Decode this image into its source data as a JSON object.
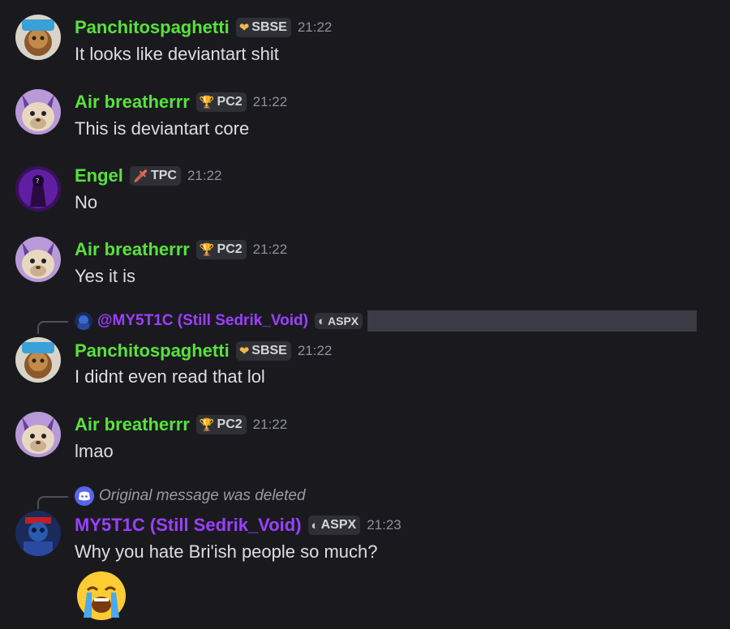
{
  "messages": [
    {
      "username": "Panchitospaghetti",
      "tag": "SBSE",
      "tag_icon": "heart-shield-icon",
      "time": "21:22",
      "text": "It looks like deviantart shit"
    },
    {
      "username": "Air breatherrr",
      "tag": "PC2",
      "tag_icon": "trophy-icon",
      "time": "21:22",
      "text": "This is deviantart core"
    },
    {
      "username": "Engel",
      "tag": "TPC",
      "tag_icon": "sword-icon",
      "time": "21:22",
      "text": "No"
    },
    {
      "username": "Air breatherrr",
      "tag": "PC2",
      "tag_icon": "trophy-icon",
      "time": "21:22",
      "text": "Yes it is"
    },
    {
      "reply": {
        "username": "@MY5T1C (Still Sedrik_Void)",
        "tag": "ASPX"
      },
      "username": "Panchitospaghetti",
      "tag": "SBSE",
      "tag_icon": "heart-shield-icon",
      "time": "21:22",
      "text": "I didnt even read that lol"
    },
    {
      "username": "Air breatherrr",
      "tag": "PC2",
      "tag_icon": "trophy-icon",
      "time": "21:22",
      "text": "lmao"
    },
    {
      "reply": {
        "deleted_text": "Original message was deleted"
      },
      "username": "MY5T1C (Still Sedrik_Void)",
      "tag": "ASPX",
      "tag_icon": "moon-icon",
      "time": "21:23",
      "text": "Why you hate Bri'ish people so much?",
      "emoji": "loudly-crying-face"
    }
  ],
  "colors": {
    "background": "#1a1a1e",
    "username_green": "#57e33b",
    "username_purple": "#9b40ff",
    "text": "#dcdee1",
    "timestamp": "#8d9199"
  }
}
